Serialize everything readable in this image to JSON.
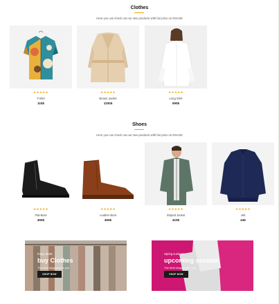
{
  "clothes": {
    "title": "Clothes",
    "subtitle": "Here you can check out our new products with fair price on ESAGE",
    "products": [
      {
        "stars": "★★★★★",
        "name": "T-shirt",
        "price": "110$"
      },
      {
        "stars": "★★★★★",
        "name": "Brown Jacket",
        "price": "1100$"
      },
      {
        "stars": "★★★★★",
        "name": "Long Shirt",
        "price": "090$"
      }
    ]
  },
  "shoes": {
    "title": "Shoes",
    "subtitle": "Here you can check out our new products with fair price on ESAGE",
    "products": [
      {
        "stars": "★★★★★",
        "name": "Flat-Boot",
        "price": "450$"
      },
      {
        "stars": "★★★★★",
        "name": "Leather Boot",
        "price": "450$"
      },
      {
        "stars": "★★★★★",
        "name": "Striped Jacket",
        "price": "410$"
      },
      {
        "stars": "★★★★★",
        "name": "Jeb",
        "price": "445"
      }
    ]
  },
  "banners": [
    {
      "tag": "Enjoy deals",
      "heading": "buy Clothes",
      "sub": "The best shopping for you",
      "button": "SHOP NOW"
    },
    {
      "tag": "Spring summer",
      "heading": "upcoming session",
      "sub": "The best shopping for you",
      "button": "SHOP NOW"
    }
  ],
  "colors": {
    "star": "#f4a300",
    "accent": "#f0a500",
    "button": "#1a1a1a"
  }
}
